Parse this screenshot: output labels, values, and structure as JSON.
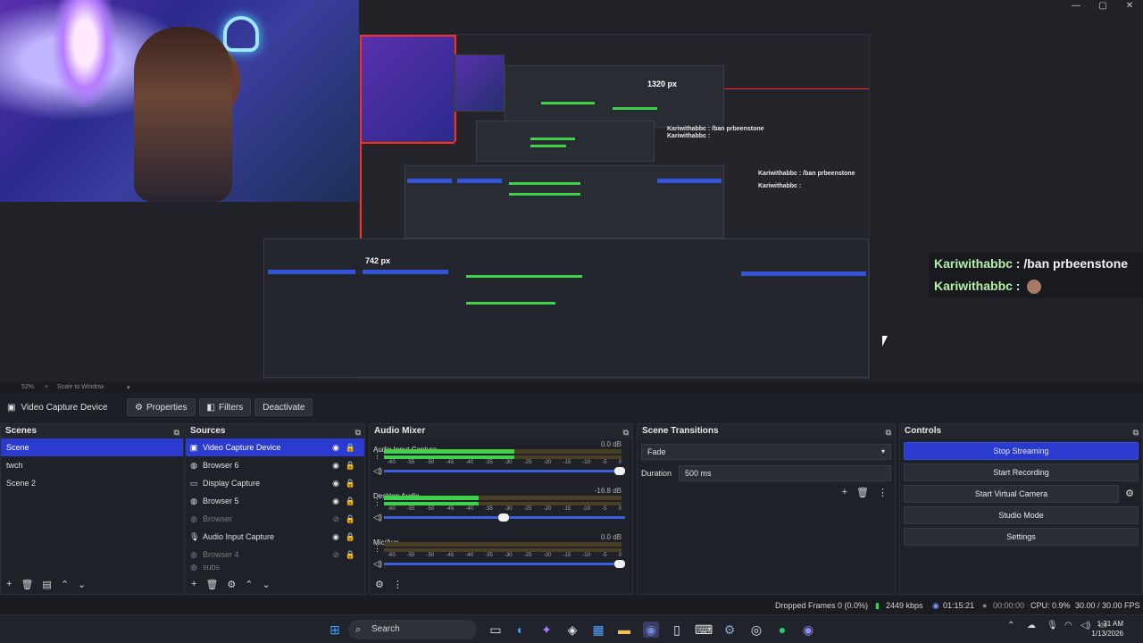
{
  "window_controls": {
    "minimize": "—",
    "maximize": "▢",
    "close": "✕"
  },
  "preview": {
    "nested_measure_width": "1320 px",
    "nested_measure_height": "742 px",
    "chat_small": [
      {
        "name": "Kariwithabbc",
        "text": " : /ban prbeenstone"
      },
      {
        "name": "Kariwithabbc",
        "text": " : "
      }
    ],
    "chat_large": [
      {
        "name": "Kariwithabbc",
        "text": " : /ban prbeenstone"
      },
      {
        "name": "Kariwithabbc",
        "text": " : "
      }
    ]
  },
  "zoombar": {
    "zoom": "52%",
    "scale_mode": "Scale to Window"
  },
  "context_bar": {
    "source_name": "Video Capture Device",
    "properties": "Properties",
    "filters": "Filters",
    "deactivate": "Deactivate"
  },
  "scenes": {
    "title": "Scenes",
    "items": [
      "Scene",
      "twch",
      "Scene 2"
    ],
    "selected": 0
  },
  "sources": {
    "title": "Sources",
    "items": [
      {
        "label": "Video Capture Device",
        "icon": "camera-icon",
        "visible": true,
        "selected": true
      },
      {
        "label": "Browser 6",
        "icon": "globe-icon",
        "visible": true
      },
      {
        "label": "Display Capture",
        "icon": "monitor-icon",
        "visible": true
      },
      {
        "label": "Browser 5",
        "icon": "globe-icon",
        "visible": true
      },
      {
        "label": "Browser",
        "icon": "globe-icon",
        "visible": false
      },
      {
        "label": "Audio Input Capture",
        "icon": "microphone-icon",
        "visible": true
      },
      {
        "label": "Browser 4",
        "icon": "globe-icon",
        "visible": false
      },
      {
        "label": "subs",
        "icon": "globe-icon",
        "visible": false
      }
    ]
  },
  "audio_mixer": {
    "title": "Audio Mixer",
    "ticks": [
      "-60",
      "-55",
      "-50",
      "-45",
      "-40",
      "-35",
      "-30",
      "-25",
      "-20",
      "-15",
      "-10",
      "-5",
      "0"
    ],
    "channels": [
      {
        "name": "Audio Input Capture",
        "db": "0.0 dB",
        "level": 0.55,
        "volume": 1.0
      },
      {
        "name": "Desktop Audio",
        "db": "-16.8 dB",
        "level": 0.4,
        "volume": 0.52
      },
      {
        "name": "Mic/Aux",
        "db": "0.0 dB",
        "level": 0.0,
        "volume": 1.0
      }
    ]
  },
  "scene_transitions": {
    "title": "Scene Transitions",
    "transition": "Fade",
    "duration_label": "Duration",
    "duration_value": "500 ms"
  },
  "controls": {
    "title": "Controls",
    "stop_streaming": "Stop Streaming",
    "start_recording": "Start Recording",
    "start_virtual_camera": "Start Virtual Camera",
    "studio_mode": "Studio Mode",
    "settings": "Settings"
  },
  "status": {
    "dropped_frames": "Dropped Frames 0 (0.0%)",
    "bitrate": "2449 kbps",
    "stream_time": "01:15:21",
    "rec_time": "00:00:00",
    "cpu": "CPU: 0.9%",
    "fps": "30.00 / 30.00 FPS"
  },
  "taskbar": {
    "search": "Search",
    "time": "1:31 AM",
    "date": "1/13/2026"
  },
  "colors": {
    "accent": "#2b3bd0",
    "meter_green": "#3fd14a",
    "red_guide": "#ff2a2a"
  }
}
